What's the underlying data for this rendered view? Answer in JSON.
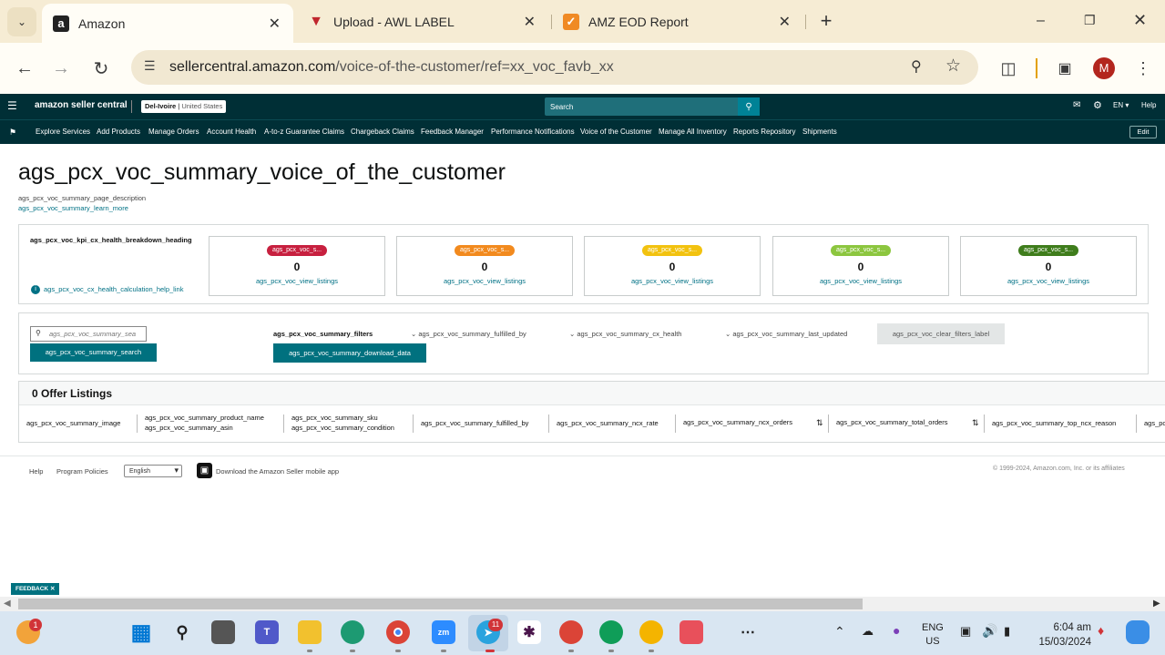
{
  "browser": {
    "tabs": [
      {
        "title": "Amazon",
        "icon": "amazon-icon",
        "active": true
      },
      {
        "title": "Upload - AWL LABEL",
        "icon": "awl-icon",
        "active": false
      },
      {
        "title": "AMZ EOD Report",
        "icon": "report-icon",
        "active": false
      }
    ],
    "new_tab": "+",
    "url_host": "sellercentral.amazon.com",
    "url_path": "/voice-of-the-customer/ref=xx_voc_favb_xx",
    "profile_initial": "M"
  },
  "header": {
    "logo": "amazon seller central",
    "store_name": "Del-Ivoire",
    "marketplace": "United States",
    "search_placeholder": "Search",
    "language": "EN",
    "help": "Help"
  },
  "nav": {
    "items": [
      "Explore Services",
      "Add Products",
      "Manage Orders",
      "Account Health",
      "A-to-z Guarantee Claims",
      "Chargeback Claims",
      "Feedback Manager",
      "Performance Notifications",
      "Voice of the Customer",
      "Manage All Inventory",
      "Reports Repository",
      "Shipments"
    ],
    "edit": "Edit"
  },
  "page": {
    "title": "ags_pcx_voc_summary_voice_of_the_customer",
    "description": "ags_pcx_voc_summary_page_description",
    "learn_more": "ags_pcx_voc_summary_learn_more"
  },
  "health": {
    "heading": "ags_pcx_voc_kpi_cx_health_breakdown_heading",
    "help_link": "ags_pcx_voc_cx_health_calculation_help_link",
    "cards": [
      {
        "pill": "ags_pcx_voc_s...",
        "color": "#c7203f",
        "count": "0",
        "link": "ags_pcx_voc_view_listings"
      },
      {
        "pill": "ags_pcx_voc_s...",
        "color": "#f28a1e",
        "count": "0",
        "link": "ags_pcx_voc_view_listings"
      },
      {
        "pill": "ags_pcx_voc_s...",
        "color": "#f2c20f",
        "count": "0",
        "link": "ags_pcx_voc_view_listings"
      },
      {
        "pill": "ags_pcx_voc_s...",
        "color": "#8cc63f",
        "count": "0",
        "link": "ags_pcx_voc_view_listings"
      },
      {
        "pill": "ags_pcx_voc_s...",
        "color": "#3f7d1c",
        "count": "0",
        "link": "ags_pcx_voc_view_listings"
      }
    ]
  },
  "filters": {
    "search_placeholder": "ags_pcx_voc_summary_sea",
    "search_button": "ags_pcx_voc_summary_search",
    "filters_label": "ags_pcx_voc_summary_filters",
    "download": "ags_pcx_voc_summary_download_data",
    "fulfilled_by": "ags_pcx_voc_summary_fulfilled_by",
    "cx_health": "ags_pcx_voc_summary_cx_health",
    "last_updated": "ags_pcx_voc_summary_last_updated",
    "clear": "ags_pcx_voc_clear_filters_label"
  },
  "listings": {
    "count_label": "0 Offer Listings",
    "columns": {
      "image": "ags_pcx_voc_summary_image",
      "product_name": "ags_pcx_voc_summary_product_name",
      "asin": "ags_pcx_voc_summary_asin",
      "sku": "ags_pcx_voc_summary_sku",
      "condition": "ags_pcx_voc_summary_condition",
      "fulfilled_by": "ags_pcx_voc_summary_fulfilled_by",
      "ncx_rate": "ags_pcx_voc_summary_ncx_rate",
      "ncx_orders": "ags_pcx_voc_summary_ncx_orders",
      "total_orders": "ags_pcx_voc_summary_total_orders",
      "top_ncx_reason": "ags_pcx_voc_summary_top_ncx_reason",
      "overflow": "ags_pc"
    }
  },
  "footer": {
    "help": "Help",
    "program_policies": "Program Policies",
    "language": "English",
    "app": "Download the Amazon Seller mobile app",
    "copyright": "© 1999-2024, Amazon.com, Inc. or its affiliates",
    "feedback": "FEEDBACK"
  },
  "taskbar": {
    "weather_badge": "1",
    "telegram_badge": "11",
    "lang": "ENG",
    "region": "US",
    "time": "6:04 am",
    "date": "15/03/2024"
  }
}
